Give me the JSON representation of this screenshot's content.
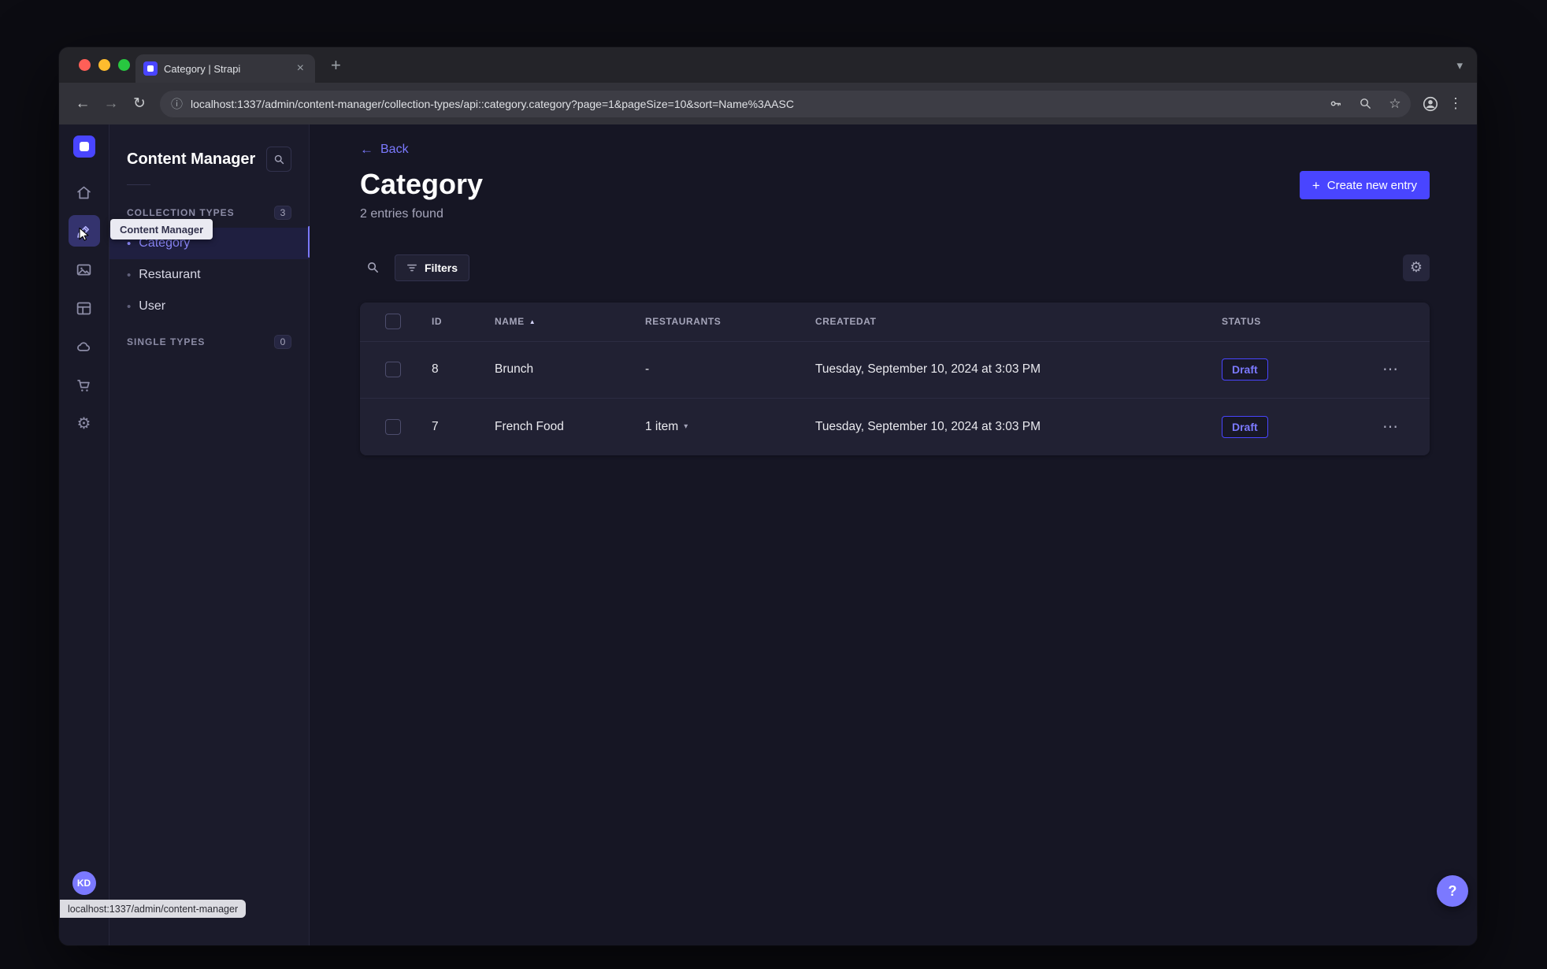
{
  "browser": {
    "tab": {
      "title": "Category | Strapi"
    },
    "url": "localhost:1337/admin/content-manager/collection-types/api::category.category?page=1&pageSize=10&sort=Name%3AASC",
    "status_bubble": "localhost:1337/admin/content-manager"
  },
  "rail": {
    "tooltip": "Content Manager",
    "avatar_initials": "KD"
  },
  "sidebar": {
    "title": "Content Manager",
    "collection_section": {
      "label": "COLLECTION TYPES",
      "badge": "3"
    },
    "items": [
      {
        "label": "Category"
      },
      {
        "label": "Restaurant"
      },
      {
        "label": "User"
      }
    ],
    "single_section": {
      "label": "SINGLE TYPES",
      "badge": "0"
    }
  },
  "main": {
    "back_label": "Back",
    "title": "Category",
    "subtitle": "2 entries found",
    "create_button_label": "Create new entry",
    "filters_label": "Filters",
    "table": {
      "headers": {
        "id": "ID",
        "name": "NAME",
        "restaurants": "RESTAURANTS",
        "createdat": "CREATEDAT",
        "status": "STATUS"
      },
      "rows": [
        {
          "id": "8",
          "name": "Brunch",
          "restaurants": "-",
          "createdat": "Tuesday, September 10, 2024 at 3:03 PM",
          "status": "Draft"
        },
        {
          "id": "7",
          "name": "French Food",
          "restaurants": "1 item",
          "createdat": "Tuesday, September 10, 2024 at 3:03 PM",
          "status": "Draft"
        }
      ]
    }
  },
  "icons": {
    "close": "×",
    "plus": "+",
    "chevron_down": "▾",
    "back_arrow": "←",
    "forward_arrow": "→",
    "reload": "↻",
    "info": "ⓘ",
    "star": "☆",
    "kebab": "⋮",
    "ellipsis": "⋯",
    "sort_asc": "▲",
    "caret_down": "▾",
    "bullet": "•",
    "gear": "⚙",
    "help": "?"
  },
  "colors": {
    "primary": "#4945ff",
    "primary_light": "#7b79ff",
    "draft_status": "#7b79ff",
    "card_bg": "#212133",
    "app_bg": "#161624"
  }
}
